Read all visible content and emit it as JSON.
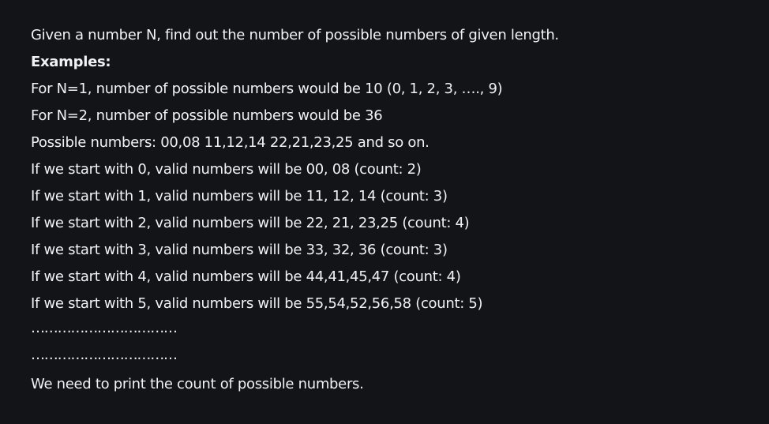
{
  "intro": "Given a number N, find out the number of possible numbers of given length.",
  "examples_heading": "Examples:",
  "lines": [
    "For N=1, number of possible numbers would be 10 (0, 1, 2, 3, …., 9)",
    "For N=2, number of possible numbers would be 36",
    "Possible numbers: 00,08 11,12,14 22,21,23,25 and so on.",
    "If we start with 0, valid numbers will be 00, 08 (count: 2)",
    "If we start with 1, valid numbers will be 11, 12, 14 (count: 3)",
    "If we start with 2, valid numbers will be 22, 21, 23,25 (count: 4)",
    "If we start with 3, valid numbers will be 33, 32, 36 (count: 3)",
    "If we start with 4, valid numbers will be 44,41,45,47 (count: 4)",
    "If we start with 5, valid numbers will be 55,54,52,56,58 (count: 5)"
  ],
  "ellipsis_1": "……………………………",
  "ellipsis_2": "……………………………",
  "conclusion": "We need to print the count of possible numbers."
}
